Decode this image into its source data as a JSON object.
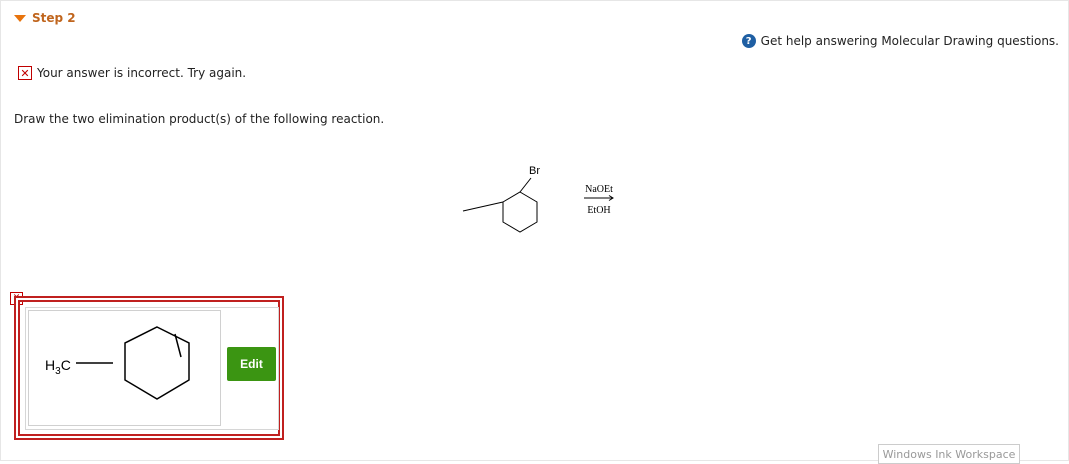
{
  "step": {
    "label": "Step 2"
  },
  "help": {
    "icon": "question-circle-icon",
    "text": "Get help answering Molecular Drawing questions."
  },
  "feedback": {
    "icon": "error-x-icon",
    "text": "Your answer is incorrect.  Try again."
  },
  "question": {
    "text": "Draw the two elimination product(s) of the following reaction."
  },
  "reaction": {
    "substituent": "Br",
    "reagent_above": "NaOEt",
    "reagent_below": "EtOH",
    "arrow_icon": "reaction-arrow-icon"
  },
  "answer": {
    "molecule_label_main": "H",
    "molecule_label_sub": "3",
    "molecule_label_tail": "C",
    "edit_label": "Edit",
    "status_icon": "error-x-icon"
  },
  "footer": {
    "ink_workspace_label": "Windows Ink Workspace"
  },
  "colors": {
    "accent_orange": "#e8730c",
    "error_red": "#c0201f",
    "edit_green": "#3b9512",
    "help_blue": "#1f5fa3"
  }
}
